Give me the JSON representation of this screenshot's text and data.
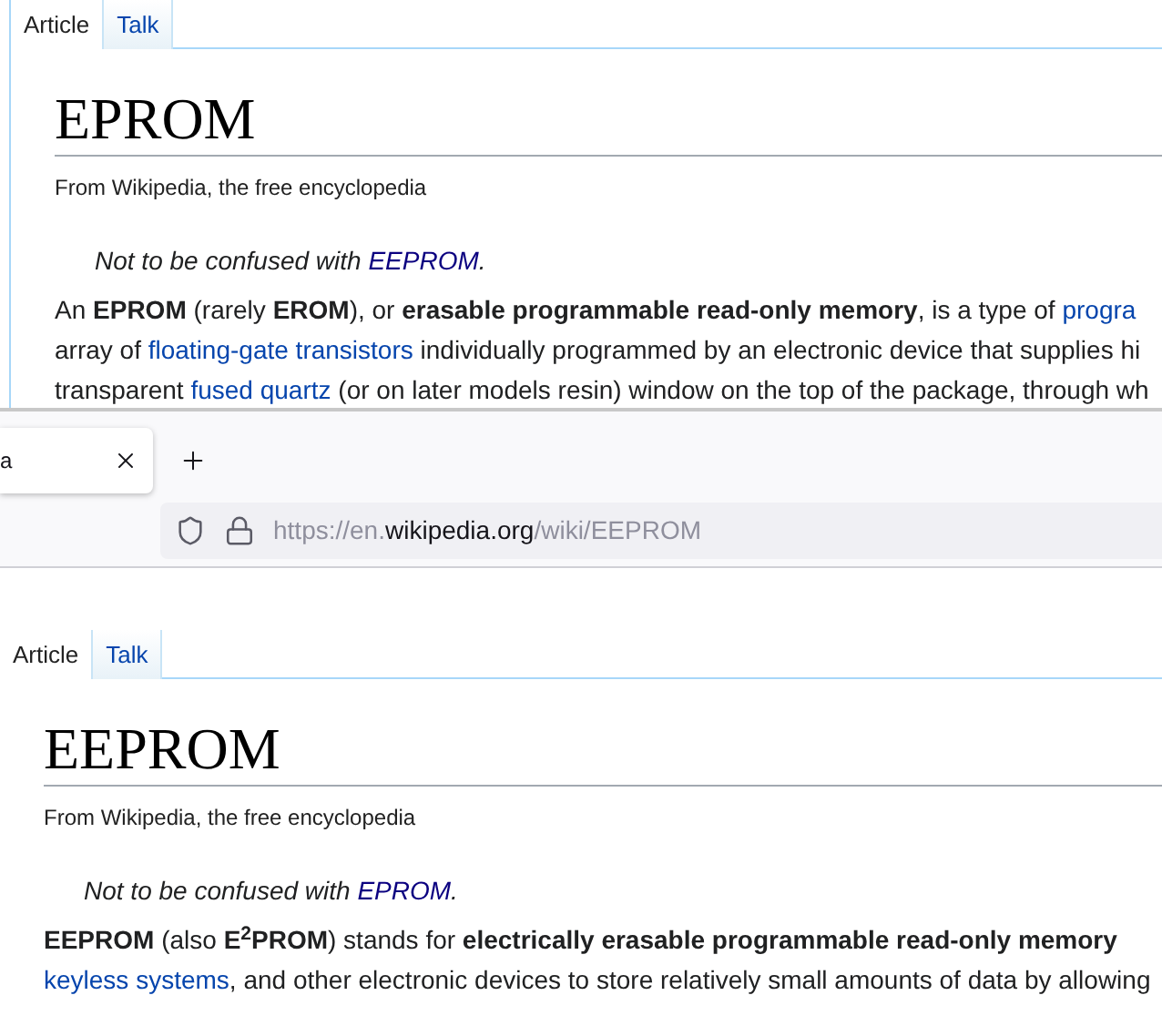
{
  "top_page": {
    "tabs": [
      {
        "label": "Article",
        "selected": true
      },
      {
        "label": "Talk",
        "selected": false
      }
    ],
    "title": "EPROM",
    "tagline": "From Wikipedia, the free encyclopedia",
    "hatnote": {
      "text": "Not to be confused with ",
      "link": "EEPROM",
      "end": "."
    },
    "lines": [
      [
        {
          "kind": "text",
          "text": "An **EPROM** (rarely **EROM**), or **erasable programmable read-only memory**, is a type of "
        },
        {
          "kind": "link",
          "text": "progra"
        }
      ],
      [
        {
          "kind": "text",
          "text": "array of "
        },
        {
          "kind": "link",
          "text": "floating-gate transistors"
        },
        {
          "kind": "text",
          "text": " individually programmed by an electronic device that supplies hi"
        }
      ],
      [
        {
          "kind": "text",
          "text": "transparent "
        },
        {
          "kind": "link",
          "text": "fused quartz"
        },
        {
          "kind": "text",
          "text": " (or on later models resin) window on the top of the package, through wh"
        }
      ]
    ]
  },
  "browser": {
    "tab": {
      "title": "a"
    },
    "url": {
      "prefix": "https://en.",
      "domain": "wikipedia.org",
      "path": "/wiki/EEPROM"
    }
  },
  "bottom_page": {
    "tabs": [
      {
        "label": "Article",
        "selected": true
      },
      {
        "label": "Talk",
        "selected": false
      }
    ],
    "title": "EEPROM",
    "tagline": "From Wikipedia, the free encyclopedia",
    "hatnote": {
      "text": "Not to be confused with ",
      "link": "EPROM",
      "end": "."
    },
    "lines": [
      [
        {
          "kind": "text",
          "text": "**EEPROM** (also **E$^{2}$PROM**) stands for **electrically erasable programmable read-only memory**"
        }
      ],
      [
        {
          "kind": "link",
          "text": "keyless systems"
        },
        {
          "kind": "text",
          "text": ", and other electronic devices to store relatively small amounts of data by allowing"
        }
      ]
    ]
  }
}
